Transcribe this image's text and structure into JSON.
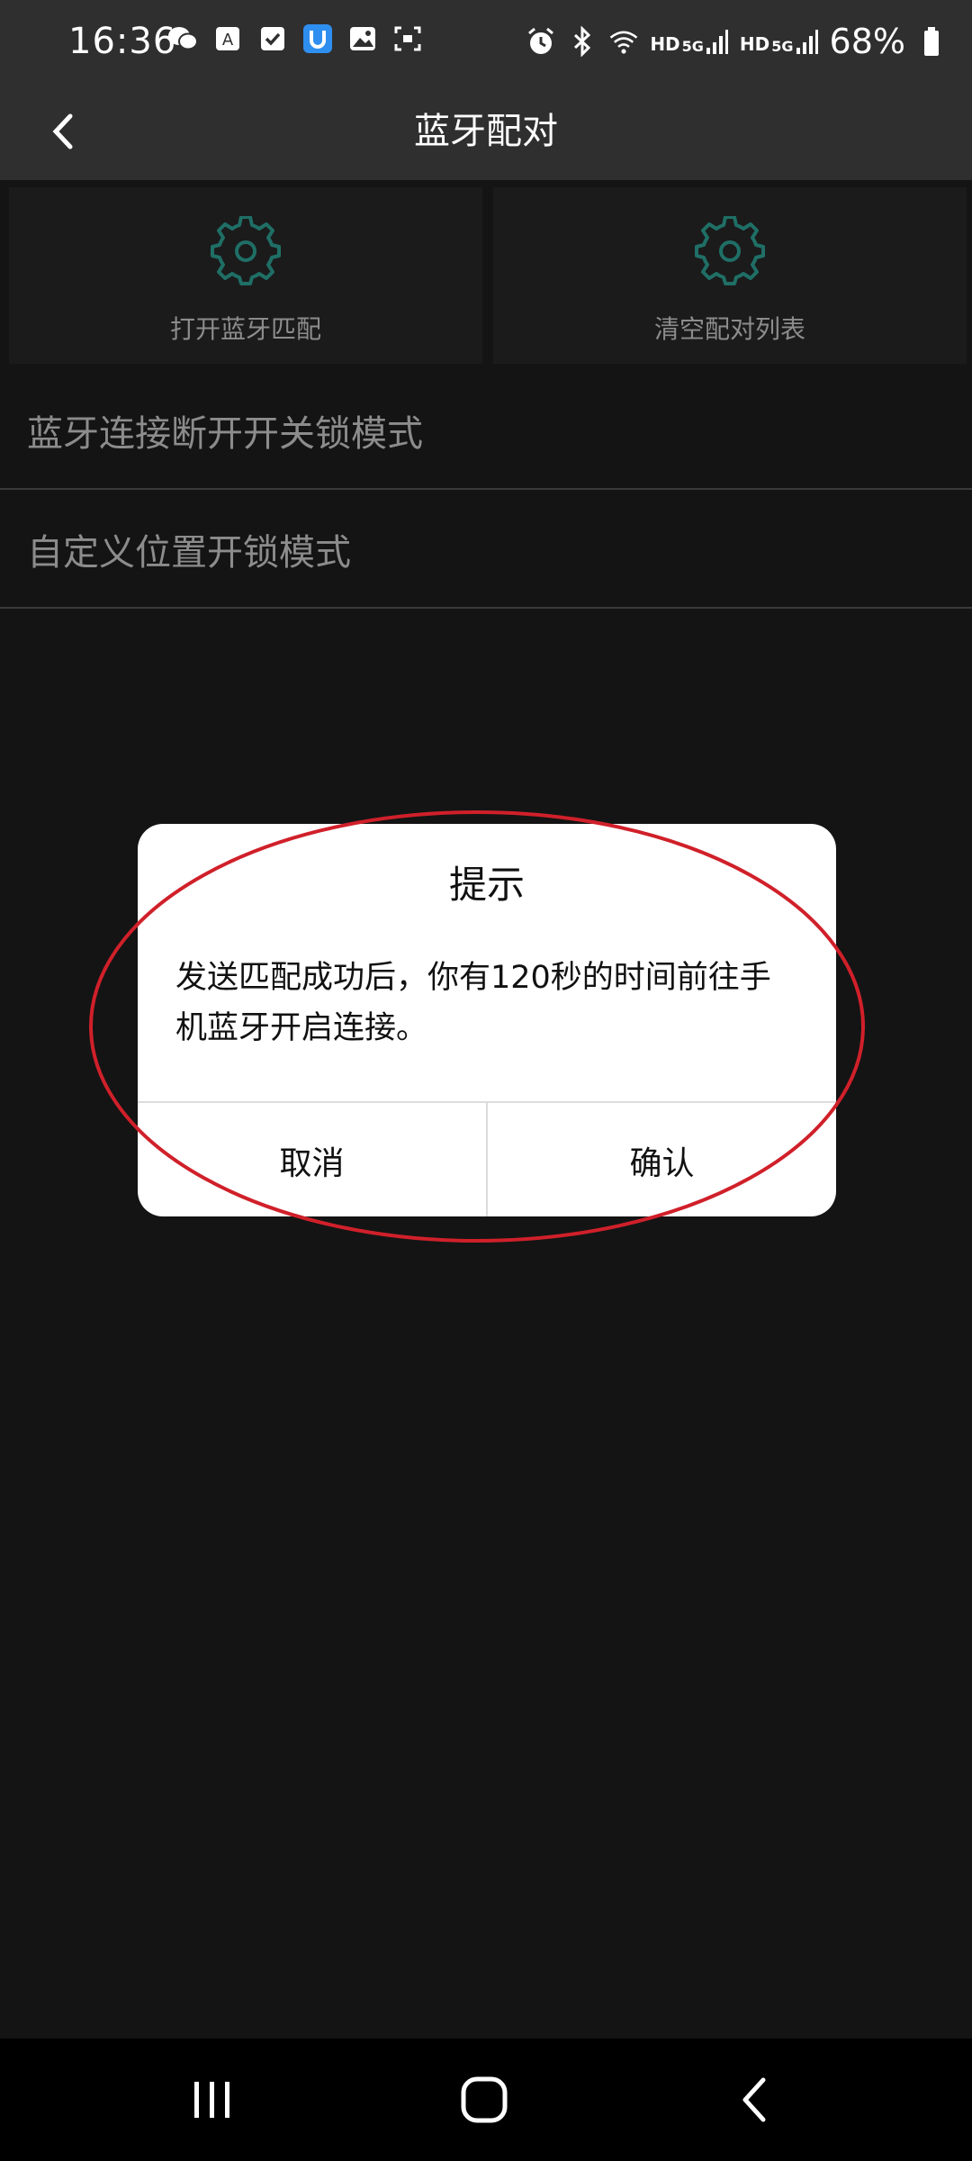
{
  "status_bar": {
    "time": "16:36",
    "left_icons": [
      "wechat-icon",
      "translate-icon",
      "checkbox-icon",
      "shield-app-icon",
      "gallery-icon",
      "screenshot-icon"
    ],
    "right_icons": [
      "alarm-icon",
      "bluetooth-icon",
      "wifi-icon",
      "hd-5g-signal-icon",
      "hd-5g-signal-icon",
      "battery-icon"
    ],
    "hd_label": "HD",
    "network_label": "5G",
    "battery": "68%"
  },
  "header": {
    "title": "蓝牙配对",
    "back_icon": "back-chevron-icon"
  },
  "tiles": [
    {
      "label": "打开蓝牙匹配",
      "icon": "gear-icon"
    },
    {
      "label": "清空配对列表",
      "icon": "gear-icon"
    }
  ],
  "list": {
    "items": [
      {
        "label": "蓝牙连接断开开关锁模式"
      },
      {
        "label": "自定义位置开锁模式"
      }
    ]
  },
  "dialog": {
    "title": "提示",
    "message": "发送匹配成功后，你有120秒的时间前往手机蓝牙开启连接。",
    "cancel_label": "取消",
    "confirm_label": "确认"
  },
  "colors": {
    "background": "#141414",
    "header": "#2f2f2f",
    "accent_teal": "#1f6f66",
    "annotation_red": "#d0202a",
    "dialog_bg": "#ffffff"
  },
  "nav_bar": {
    "icons": [
      "recent-apps-icon",
      "home-icon",
      "back-icon"
    ]
  }
}
